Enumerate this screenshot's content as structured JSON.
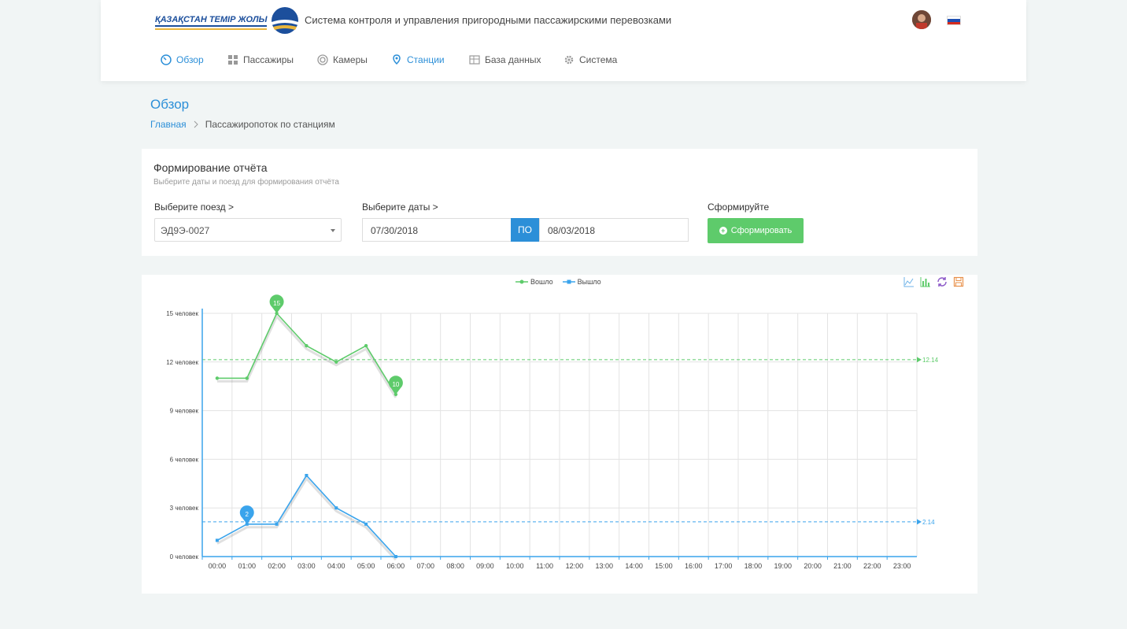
{
  "header": {
    "logo_text": "ҚАЗАҚСТАН ТЕМІР ЖОЛЫ",
    "app_title": "Система контроля и управления пригородными пассажирскими перевозками",
    "flag_colors": [
      "#ffffff",
      "#1f4fb3",
      "#d52b1e"
    ]
  },
  "nav": [
    {
      "label": "Обзор",
      "icon": "dashboard-icon",
      "active": true
    },
    {
      "label": "Пассажиры",
      "icon": "grid-icon",
      "active": false
    },
    {
      "label": "Камеры",
      "icon": "camera-icon",
      "active": false
    },
    {
      "label": "Станции",
      "icon": "map-pin-icon",
      "active": true
    },
    {
      "label": "База данных",
      "icon": "table-icon",
      "active": false
    },
    {
      "label": "Система",
      "icon": "gear-icon",
      "active": false
    }
  ],
  "page": {
    "title": "Обзор",
    "breadcrumb_home": "Главная",
    "breadcrumb_current": "Пассажиропоток по станциям"
  },
  "form": {
    "title": "Формирование отчёта",
    "subtitle": "Выберите даты и поезд для формирования отчёта",
    "train_label": "Выберите поезд >",
    "train_value": "ЭД9Э-0027",
    "dates_label": "Выберите даты >",
    "date_from": "07/30/2018",
    "date_to_label": "ПО",
    "date_to": "08/03/2018",
    "submit_label": "Сформируйте",
    "submit_button": "Сформировать"
  },
  "colors": {
    "accent": "#2c8fd8",
    "green": "#5ecb6b",
    "blue": "#3aa4ec"
  },
  "chart_data": {
    "type": "line",
    "categories": [
      "00:00",
      "01:00",
      "02:00",
      "03:00",
      "04:00",
      "05:00",
      "06:00",
      "07:00",
      "08:00",
      "09:00",
      "10:00",
      "11:00",
      "12:00",
      "13:00",
      "14:00",
      "15:00",
      "16:00",
      "17:00",
      "18:00",
      "19:00",
      "20:00",
      "21:00",
      "22:00",
      "23:00"
    ],
    "y_ticks": [
      "0 человек",
      "3 человек",
      "6 человек",
      "9 человек",
      "12 человек",
      "15 человек"
    ],
    "ylim": [
      0,
      15
    ],
    "grid": true,
    "legend": "top-center",
    "series": [
      {
        "name": "Вошло",
        "color": "#5ecb6b",
        "marker": "circle",
        "values": [
          11,
          11,
          15,
          13,
          12,
          13,
          10
        ],
        "max_label": "15",
        "min_label": "10",
        "mean": 12.14,
        "mean_label": "12.14"
      },
      {
        "name": "Вышло",
        "color": "#3aa4ec",
        "marker": "square",
        "values": [
          1,
          2,
          2,
          5,
          3,
          2,
          0
        ],
        "max_label": "",
        "min_label": "2",
        "mean": 2.14,
        "mean_label": "2.14"
      }
    ],
    "toolbox": [
      "line-chart-icon",
      "bar-chart-icon",
      "refresh-icon",
      "save-icon"
    ]
  }
}
